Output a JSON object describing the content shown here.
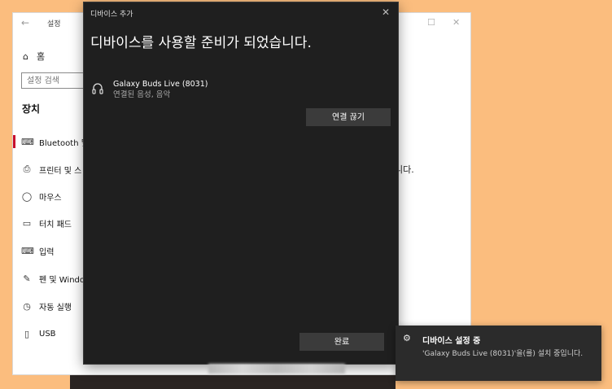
{
  "settings": {
    "title": "설정",
    "home": "홈",
    "search_placeholder": "설정 검색",
    "section": "장치",
    "nav": [
      {
        "label": "Bluetooth 및"
      },
      {
        "label": "프린터 및 스"
      },
      {
        "label": "마우스"
      },
      {
        "label": "터치 패드"
      },
      {
        "label": "입력"
      },
      {
        "label": "펜 및 Windo"
      },
      {
        "label": "자동 실행"
      },
      {
        "label": "USB"
      }
    ],
    "right_fragments": [
      "니다."
    ]
  },
  "dialog": {
    "title": "디바이스 추가",
    "heading": "디바이스를 사용할 준비가 되었습니다.",
    "device_name": "Galaxy Buds Live (8031)",
    "device_status": "연결된 음성, 음악",
    "disconnect_button": "연결 끊기",
    "done_button": "완료"
  },
  "toast": {
    "title": "디바이스 설정 중",
    "body": "'Galaxy Buds Live (8031)'을(를) 설치 중입니다."
  },
  "colors": {
    "desktop": "#fbbd7e",
    "dialog_bg": "#1f1f1f",
    "button": "#3b3b3b",
    "accent_nav": "#c8102e"
  }
}
